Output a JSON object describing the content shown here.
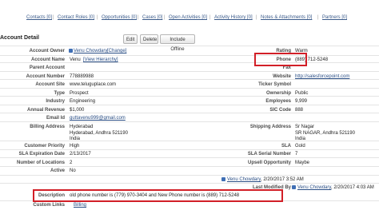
{
  "top_links": [
    "Contacts [0]",
    "Contact Roles [0]",
    "Opportunities [0]",
    "Cases [0]",
    "Open Activities [0]",
    "Activity History [0]",
    "Notes & Attachments [0]",
    "Partners [0]"
  ],
  "section_title": "Account Detail",
  "buttons": {
    "edit": "Edit",
    "delete": "Delete",
    "include_offline": "Include Offline"
  },
  "left": {
    "owner": {
      "label": "Account Owner",
      "value": "Venu Chowdary",
      "change": "[Change]"
    },
    "name": {
      "label": "Account Name",
      "value": "Venu",
      "link": "[View Hierarchy]"
    },
    "parent": {
      "label": "Parent Account",
      "value": ""
    },
    "number": {
      "label": "Account Number",
      "value": "778889988"
    },
    "site": {
      "label": "Account Site",
      "value": "www.teluguplace.com"
    },
    "type": {
      "label": "Type",
      "value": "Prospect"
    },
    "industry": {
      "label": "Industry",
      "value": "Engineering"
    },
    "revenue": {
      "label": "Annual Revenue",
      "value": "$1,000"
    },
    "email": {
      "label": "Email Id",
      "value": "guttavenu999@gmail.com"
    },
    "billing": {
      "label": "Billing Address",
      "line1": "Hyderabad",
      "line2": "Hyderabad, Andhra 521190",
      "line3": "India"
    },
    "priority": {
      "label": "Customer Priority",
      "value": "High"
    },
    "sla_date": {
      "label": "SLA Expiration Date",
      "value": "2/13/2017"
    },
    "locations": {
      "label": "Number of Locations",
      "value": "2"
    },
    "active": {
      "label": "Active",
      "value": "No"
    },
    "description": {
      "label": "Description",
      "value": "old phone number is (779) 970-3404 and New Phone number is (889) 712-5248"
    },
    "custom_links": {
      "label": "Custom Links",
      "value": "Billing"
    }
  },
  "right": {
    "rating": {
      "label": "Rating",
      "value": "Warm"
    },
    "phone": {
      "label": "Phone",
      "value": "(889) 712-5248"
    },
    "fax": {
      "label": "Fax",
      "value": ""
    },
    "website": {
      "label": "Website",
      "value": "http://salesforcepoint.com"
    },
    "ticker": {
      "label": "Ticker Symbol",
      "value": ""
    },
    "ownership": {
      "label": "Ownership",
      "value": "Public"
    },
    "employees": {
      "label": "Employees",
      "value": "9,999"
    },
    "sic": {
      "label": "SIC Code",
      "value": "888"
    },
    "shipping": {
      "label": "Shipping Address",
      "line1": "Sr Nagar",
      "line2": "SR NAGAR, Andhra 521190",
      "line3": "India"
    },
    "sla": {
      "label": "SLA",
      "value": "Gold"
    },
    "sla_serial": {
      "label": "SLA Serial Number",
      "value": "7"
    },
    "upsell": {
      "label": "Upsell Opportunity",
      "value": "Maybe"
    },
    "modified": {
      "label": "Last Modified By",
      "user": "Venu Chowdary",
      "date": ", 2/20/2017 4:03 AM"
    }
  },
  "created_row": {
    "user": "Venu Chowdary",
    "date": ", 2/20/2017 3:52 AM"
  },
  "highlight_color": "#d21f27"
}
